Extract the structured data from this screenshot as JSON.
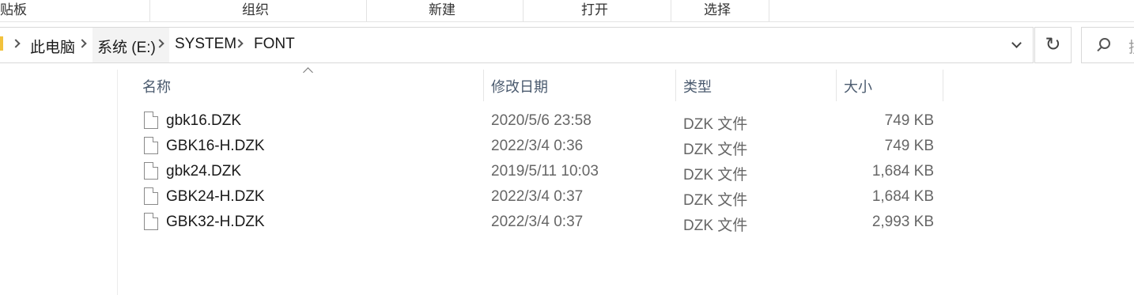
{
  "ribbon": {
    "groups": [
      "贴板",
      "组织",
      "新建",
      "打开",
      "选择"
    ]
  },
  "address": {
    "crumbs": [
      "此电脑",
      "系统 (E:)",
      "SYSTEM",
      "FONT"
    ],
    "refresh_icon": "↻"
  },
  "search": {
    "placeholder_visible": "搜"
  },
  "columns": {
    "name": "名称",
    "date": "修改日期",
    "type": "类型",
    "size": "大小"
  },
  "files": [
    {
      "name": "gbk16.DZK",
      "date": "2020/5/6 23:58",
      "type": "DZK 文件",
      "size": "749 KB"
    },
    {
      "name": "GBK16-H.DZK",
      "date": "2022/3/4 0:36",
      "type": "DZK 文件",
      "size": "749 KB"
    },
    {
      "name": "gbk24.DZK",
      "date": "2019/5/11 10:03",
      "type": "DZK 文件",
      "size": "1,684 KB"
    },
    {
      "name": "GBK24-H.DZK",
      "date": "2022/3/4 0:37",
      "type": "DZK 文件",
      "size": "1,684 KB"
    },
    {
      "name": "GBK32-H.DZK",
      "date": "2022/3/4 0:37",
      "type": "DZK 文件",
      "size": "2,993 KB"
    }
  ]
}
